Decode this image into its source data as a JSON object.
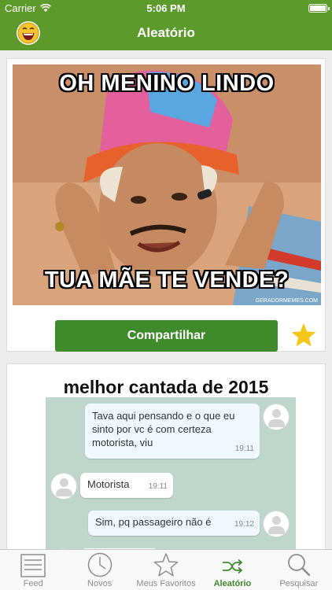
{
  "status_bar": {
    "carrier": "Carrier",
    "time": "5:06 PM",
    "battery_level": 1.0
  },
  "nav": {
    "title": "Aleatório",
    "logo_icon": "emoji-laugh-icon"
  },
  "posts": [
    {
      "top_text": "OH MENINO LINDO",
      "bottom_text": "TUA MÃE TE VENDE?",
      "watermark": "GERADORMEMES.COM",
      "share_label": "Compartilhar",
      "favorite_icon": "star-icon"
    },
    {
      "title": "melhor cantada de 2015",
      "messages": [
        {
          "direction": "out",
          "text": "Tava aqui pensando e o que eu sinto por vc é com certeza motorista, viu",
          "time": "19:11"
        },
        {
          "direction": "in",
          "text": "Motorista",
          "time": "19:11"
        },
        {
          "direction": "out",
          "text": "Sim, pq passageiro não é",
          "time": "19:12"
        }
      ]
    }
  ],
  "tabs": [
    {
      "label": "Feed",
      "icon": "list-icon",
      "active": false
    },
    {
      "label": "Novos",
      "icon": "clock-icon",
      "active": false
    },
    {
      "label": "Meus Favoritos",
      "icon": "star-outline-icon",
      "active": false
    },
    {
      "label": "Aleatório",
      "icon": "shuffle-icon",
      "active": true
    },
    {
      "label": "Pesquisar",
      "icon": "search-icon",
      "active": false
    }
  ],
  "colors": {
    "brand_green": "#5c9a2b",
    "button_green": "#3f8a2a",
    "star_gold": "#f5c518",
    "tab_inactive": "#8e8e8e"
  }
}
